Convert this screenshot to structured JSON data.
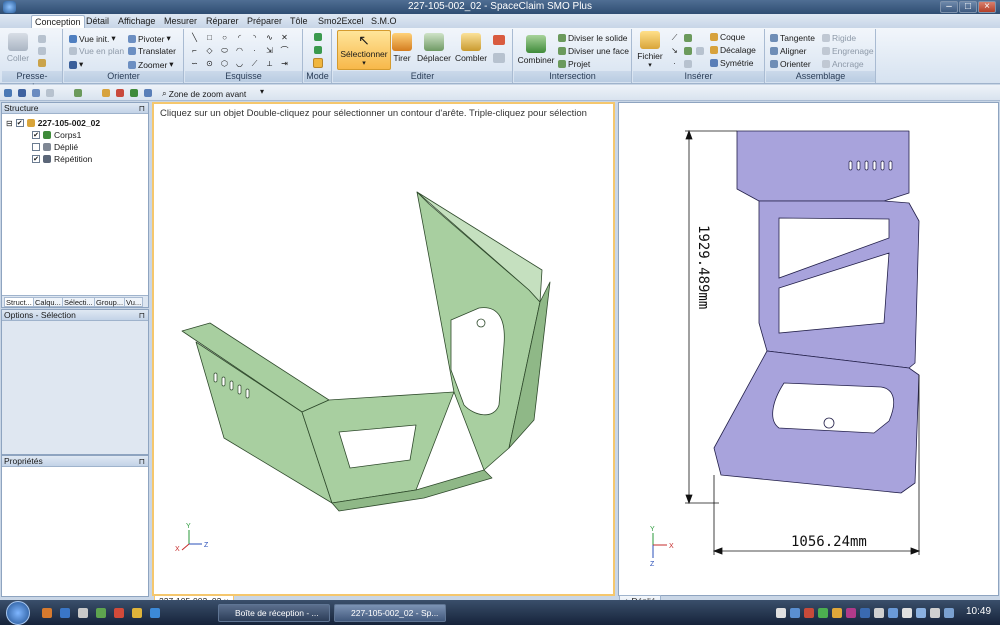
{
  "window": {
    "title": "227-105-002_02 - SpaceClaim SMO Plus"
  },
  "menu_tabs": [
    "Conception",
    "Détail",
    "Affichage",
    "Mesurer",
    "Réparer",
    "Préparer",
    "Tôle",
    "Smo2Excel",
    "S.M.O"
  ],
  "ribbon": {
    "clipboard": {
      "label": "Presse-papiers",
      "paste": "Coller"
    },
    "orient": {
      "label": "Orienter",
      "view_init": "Vue init.",
      "plan_view": "Vue en plan",
      "pivot": "Pivoter",
      "translate": "Translater",
      "zoom": "Zoomer"
    },
    "sketch": {
      "label": "Esquisse"
    },
    "mode": {
      "label": "Mode"
    },
    "edit": {
      "label": "Editer",
      "select": "Sélectionner",
      "pull": "Tirer",
      "move": "Déplacer",
      "fill": "Combler"
    },
    "intersection": {
      "label": "Intersection",
      "combine": "Combiner",
      "split_solid": "Diviser le solide",
      "split_face": "Diviser une face",
      "project": "Projet"
    },
    "insert": {
      "label": "Insérer",
      "file": "Fichier",
      "shell": "Coque",
      "offset": "Décalage",
      "symmetry": "Symétrie"
    },
    "assembly": {
      "label": "Assemblage",
      "tangent": "Tangente",
      "align": "Aligner",
      "orient": "Orienter",
      "rigid": "Rigide",
      "gear": "Engrenage",
      "anchor": "Ancrage"
    }
  },
  "quick_toolbar": {
    "zoom_label": "Zone de zoom avant"
  },
  "structure_panel": {
    "title": "Structure",
    "root": "227-105-002_02",
    "items": [
      {
        "label": "Corps1",
        "checked": true
      },
      {
        "label": "Déplié",
        "checked": false
      },
      {
        "label": "Répétition",
        "checked": true
      }
    ],
    "tabs": [
      "Struct...",
      "Calqu...",
      "Sélecti...",
      "Group...",
      "Vu..."
    ]
  },
  "options_panel": {
    "title": "Options - Sélection"
  },
  "properties_panel": {
    "title": "Propriétés"
  },
  "viewport_left": {
    "hint": "Cliquez sur un objet  Double-cliquez pour sélectionner un contour d'arête. Triple-cliquez pour sélection",
    "tab": "227-105-002_02"
  },
  "viewport_right": {
    "dim_height": "1929.489mm",
    "dim_width": "1056.24mm",
    "tab": "Déplié"
  },
  "taskbar": {
    "tasks": [
      "Boîte de réception - ...",
      "227-105-002_02 - Sp..."
    ],
    "clock": "10:49"
  },
  "colors": {
    "part_green": "#a8cfa0",
    "part_purple": "#a8a3dc",
    "accent": "#f7b84a"
  }
}
